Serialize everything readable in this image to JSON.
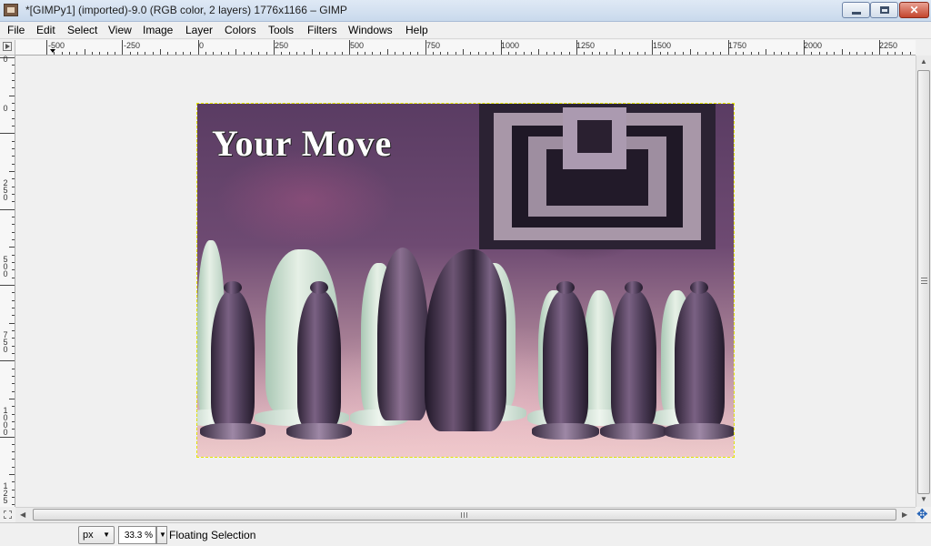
{
  "window": {
    "title": "*[GIMPy1] (imported)-9.0 (RGB color, 2 layers) 1776x1166 – GIMP"
  },
  "menubar": {
    "items": [
      {
        "label": "File"
      },
      {
        "label": "Edit"
      },
      {
        "label": "Select"
      },
      {
        "label": "View"
      },
      {
        "label": "Image"
      },
      {
        "label": "Layer"
      },
      {
        "label": "Colors"
      },
      {
        "label": "Tools"
      },
      {
        "label": "Filters"
      },
      {
        "label": "Windows"
      },
      {
        "label": "Help"
      }
    ]
  },
  "rulers": {
    "horizontal": [
      "-500",
      "-250",
      "0",
      "250",
      "500",
      "750",
      "1000",
      "1250",
      "1500",
      "1750",
      "2000",
      "2250"
    ],
    "vertical": [
      "0",
      "0",
      "2 5 0",
      "5 0 0",
      "7 5 0",
      "1 0 0 0",
      "1 2 5"
    ]
  },
  "canvas": {
    "overlay_text": "Your Move"
  },
  "statusbar": {
    "unit": "px",
    "zoom": "33.3 %",
    "message": "Floating Selection"
  },
  "icons": {
    "app": "gimp-icon",
    "minimize": "minimize-icon",
    "maximize": "maximize-icon",
    "close": "close-icon",
    "navigate": "navigate-icon",
    "quick_mask": "quick-mask-icon"
  }
}
